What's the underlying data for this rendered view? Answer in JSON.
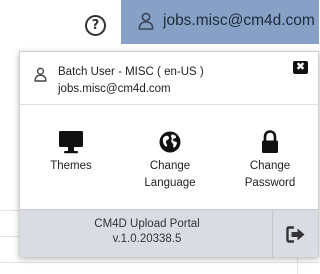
{
  "topbar": {
    "help_icon": "question-circle-icon",
    "help_glyph": "?",
    "user_icon": "user-icon",
    "user_email": "jobs.misc@cm4d.com",
    "accent_color": "#87a1c6"
  },
  "user_panel": {
    "user_icon": "user-icon",
    "display_name": "Batch User - MISC ( en-US )",
    "email": "jobs.misc@cm4d.com",
    "close_icon": "close-icon",
    "close_glyph": "✖",
    "actions": [
      {
        "label": "Themes",
        "icon": "monitor-icon"
      },
      {
        "label": "Change\nLanguage",
        "icon": "globe-icon"
      },
      {
        "label": "Change\nPassword",
        "icon": "lock-icon"
      }
    ],
    "footer": {
      "portal_name": "CM4D Upload Portal",
      "version": "v.1.0.20338.5",
      "logout_icon": "logout-icon",
      "background": "#d9dde3"
    }
  }
}
